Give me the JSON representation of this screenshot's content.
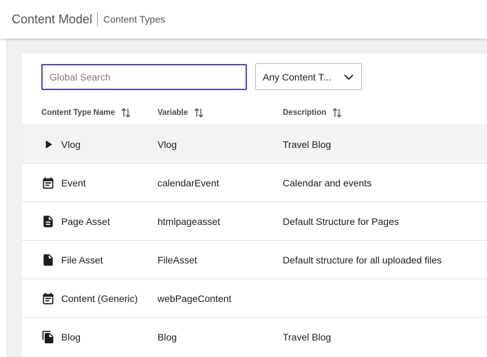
{
  "header": {
    "title": "Content Model",
    "breadcrumb": "Content Types"
  },
  "toolbar": {
    "search_placeholder": "Global Search",
    "filter_value": "Any Content T..."
  },
  "table": {
    "columns": [
      {
        "label": "Content Type Name"
      },
      {
        "label": "Variable"
      },
      {
        "label": "Description"
      }
    ],
    "rows": [
      {
        "icon": "play-arrow-icon",
        "name": "Vlog",
        "variable": "Vlog",
        "description": "Travel Blog"
      },
      {
        "icon": "calendar-icon",
        "name": "Event",
        "variable": "calendarEvent",
        "description": "Calendar and events"
      },
      {
        "icon": "document-icon",
        "name": "Page Asset",
        "variable": "htmlpageasset",
        "description": "Default Structure for Pages"
      },
      {
        "icon": "file-icon",
        "name": "File Asset",
        "variable": "FileAsset",
        "description": "Default structure for all uploaded files"
      },
      {
        "icon": "calendar-icon",
        "name": "Content (Generic)",
        "variable": "webPageContent",
        "description": ""
      },
      {
        "icon": "file-copy-icon",
        "name": "Blog",
        "variable": "Blog",
        "description": "Travel Blog"
      }
    ]
  },
  "colors": {
    "accent": "#4346d6",
    "hover_row": "#f3f3f3",
    "background": "#f1f1f1"
  }
}
